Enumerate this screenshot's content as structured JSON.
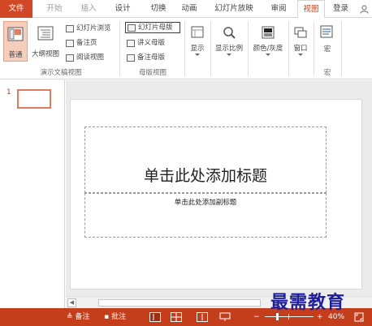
{
  "tabs": {
    "file": "文件",
    "home": "开始",
    "insert": "插入",
    "design": "设计",
    "transitions": "切换",
    "animations": "动画",
    "slideshow": "幻灯片放映",
    "review": "审阅",
    "view": "视图",
    "login": "登录"
  },
  "ribbon": {
    "presentation_views": {
      "label": "演示文稿视图",
      "normal": "普通",
      "outline": "大纲视图",
      "slide_sorter": "幻灯片浏览",
      "notes_page": "备注页",
      "reading_view": "阅读视图"
    },
    "master_views": {
      "label": "母版视图",
      "slide_master": "幻灯片母版",
      "handout_master": "讲义母版",
      "notes_master": "备注母版"
    },
    "show": {
      "label": "显示"
    },
    "zoom": {
      "label": "显示比例"
    },
    "color": {
      "label": "颜色/灰度"
    },
    "window": {
      "label": "窗口"
    },
    "macros": {
      "label": "宏",
      "group_label": "宏"
    }
  },
  "thumbnails": [
    {
      "number": "1"
    }
  ],
  "slide": {
    "title_placeholder": "单击此处添加标题",
    "subtitle_placeholder": "单击此处添加副标题"
  },
  "status": {
    "notes": "备注",
    "comments": "批注",
    "zoom": "40%",
    "minus": "−",
    "plus": "+"
  },
  "watermark": "最需教育",
  "colors": {
    "accent": "#c43e1c",
    "file_tab": "#d24726",
    "selected": "#f5cdbd"
  }
}
